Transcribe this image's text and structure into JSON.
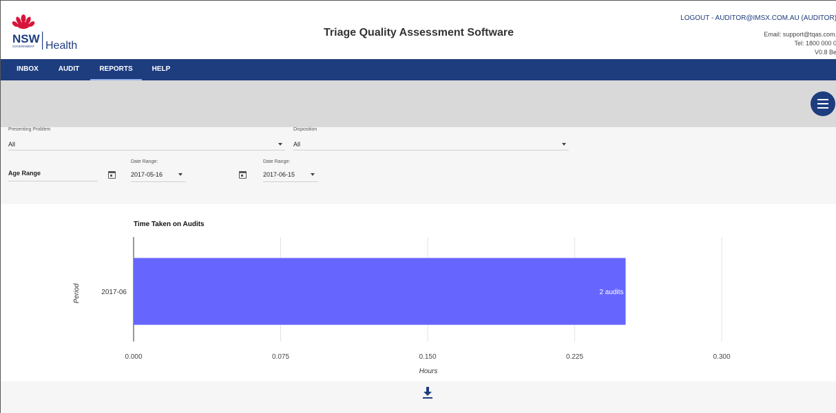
{
  "header": {
    "logo_nsw": "NSW",
    "logo_government": "GOVERNMENT",
    "logo_health": "Health",
    "app_title": "Triage Quality Assessment Software",
    "logout": "LOGOUT - AUDITOR@IMSX.COM.AU (AUDITOR)",
    "email": "Email: support@tqas.com.",
    "tel": "Tel: 1800 000 0",
    "version": "V0.8 Be"
  },
  "nav": {
    "items": [
      {
        "label": "INBOX"
      },
      {
        "label": "AUDIT"
      },
      {
        "label": "REPORTS",
        "active": true
      },
      {
        "label": "HELP"
      }
    ]
  },
  "filters": {
    "presenting_problem": {
      "label": "Presenting Problem",
      "value": "All"
    },
    "disposition": {
      "label": "Disposition",
      "value": "All"
    },
    "age_range": {
      "value": "Age Range"
    },
    "date_from": {
      "label": "Date Range:",
      "value": "2017-05-16"
    },
    "date_to": {
      "label": "Date Range:",
      "value": "2017-06-15"
    }
  },
  "colors": {
    "nav": "#1d3d7f",
    "bar": "#6666ff",
    "banner": "#d9d9d9"
  },
  "chart_data": {
    "type": "bar",
    "orientation": "horizontal",
    "title": "Time Taken on Audits",
    "xlabel": "Hours",
    "ylabel": "Period",
    "categories": [
      "2017-06"
    ],
    "values": [
      0.251
    ],
    "data_labels": [
      "2 audits"
    ],
    "xlim": [
      0,
      0.3
    ],
    "xticks": [
      "0.000",
      "0.075",
      "0.150",
      "0.225",
      "0.300"
    ],
    "grid": true
  },
  "icons": {
    "menu": "hamburger-menu-icon",
    "download": "download-icon",
    "calendar": "calendar-icon"
  }
}
